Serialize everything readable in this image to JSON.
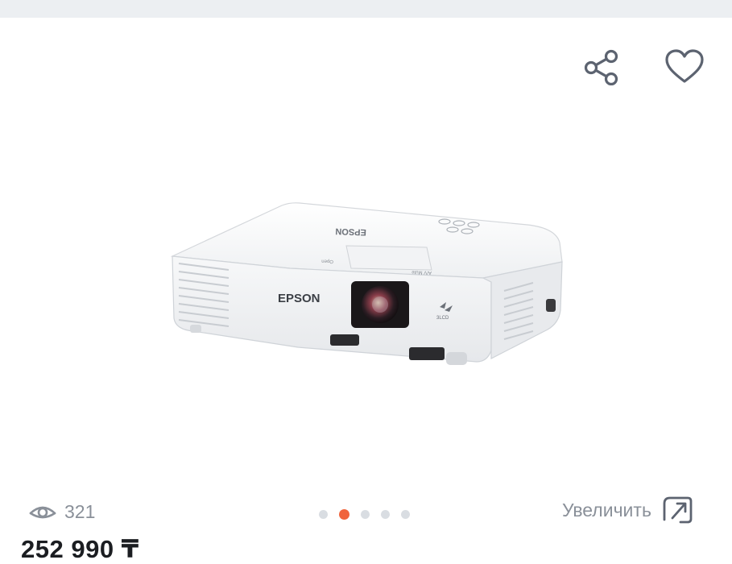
{
  "header": {
    "share_icon": "share-icon",
    "favorite_icon": "heart-icon"
  },
  "product": {
    "image_brand_text": "EPSON",
    "image_top_brand_text": "EPSON",
    "image_feature_badge": "3LCD",
    "image_control_text": "A/V Mute",
    "image_open_text": "Open",
    "views_count": "321",
    "views_icon": "eye-icon",
    "price": "252 990 ₸"
  },
  "gallery": {
    "total_slides": 5,
    "active_index": 1
  },
  "zoom": {
    "label": "Увеличить",
    "icon": "expand-icon"
  },
  "colors": {
    "accent": "#f0643c",
    "muted_text": "#8a9099",
    "icon_stroke": "#5c6370",
    "top_bar": "#eceff2"
  }
}
